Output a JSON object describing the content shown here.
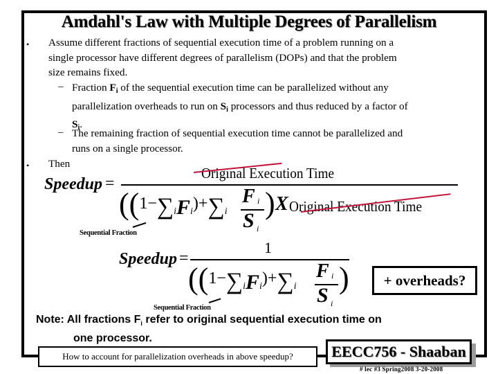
{
  "slide": {
    "title": "Amdahl's Law with Multiple Degrees of Parallelism",
    "bullets": [
      {
        "lines": [
          "Assume different fractions of sequential execution time of a problem running on a",
          "single processor  have different degrees of parallelism (DOPs) and that the problem",
          "size remains fixed."
        ],
        "subbullets": [
          {
            "parts": {
              "pre": "Fraction ",
              "F": "F",
              "i": "i",
              "mid": " of the sequential execution time can be parallelized without any",
              "line2a": "parallelization overheads to run on ",
              "S": "S",
              "i2": "i",
              "line2b": " processors and thus reduced by a factor of",
              "line3S": "S",
              "line3i": "i",
              "line3end": "."
            }
          },
          {
            "lines": [
              "The remaining fraction of sequential execution time cannot be parallelized and",
              "runs on a single processor."
            ]
          }
        ]
      },
      {
        "lines": [
          "Then"
        ]
      }
    ],
    "bullet_symbol": "•",
    "dash_symbol": "–"
  },
  "formula1": {
    "lhs": "Speedup",
    "equals": "=",
    "numerator": "Original  Execution   Time",
    "denominator": {
      "open": "((1 − ",
      "sum1": "∑",
      "sub_i": "i",
      "F": "F",
      "close1": ") + ",
      "sum2": "∑",
      "frac_num": "F",
      "frac_den": "S",
      "close2": ")",
      "times": "X",
      "tail": "Original  Execution   Time"
    },
    "annotation": "Sequential Fraction"
  },
  "formula2": {
    "lhs": "Speedup",
    "equals": "=",
    "numerator": "1",
    "annotation": "Sequential Fraction"
  },
  "overheads_box": "+ overheads?",
  "note": {
    "prefix": "Note:  All fractions F",
    "sub": "i",
    "rest": " refer to original sequential execution time on",
    "line2": "one processor."
  },
  "question_box": "How to account for parallelization overheads in above speedup?",
  "course_box": "EECC756 - Shaaban",
  "footer": "#  lec #3   Spring2008   3-20-2008",
  "colors": {
    "strike": "#c0143c",
    "frame": "#000000",
    "shadow": "#9b9b9b"
  }
}
